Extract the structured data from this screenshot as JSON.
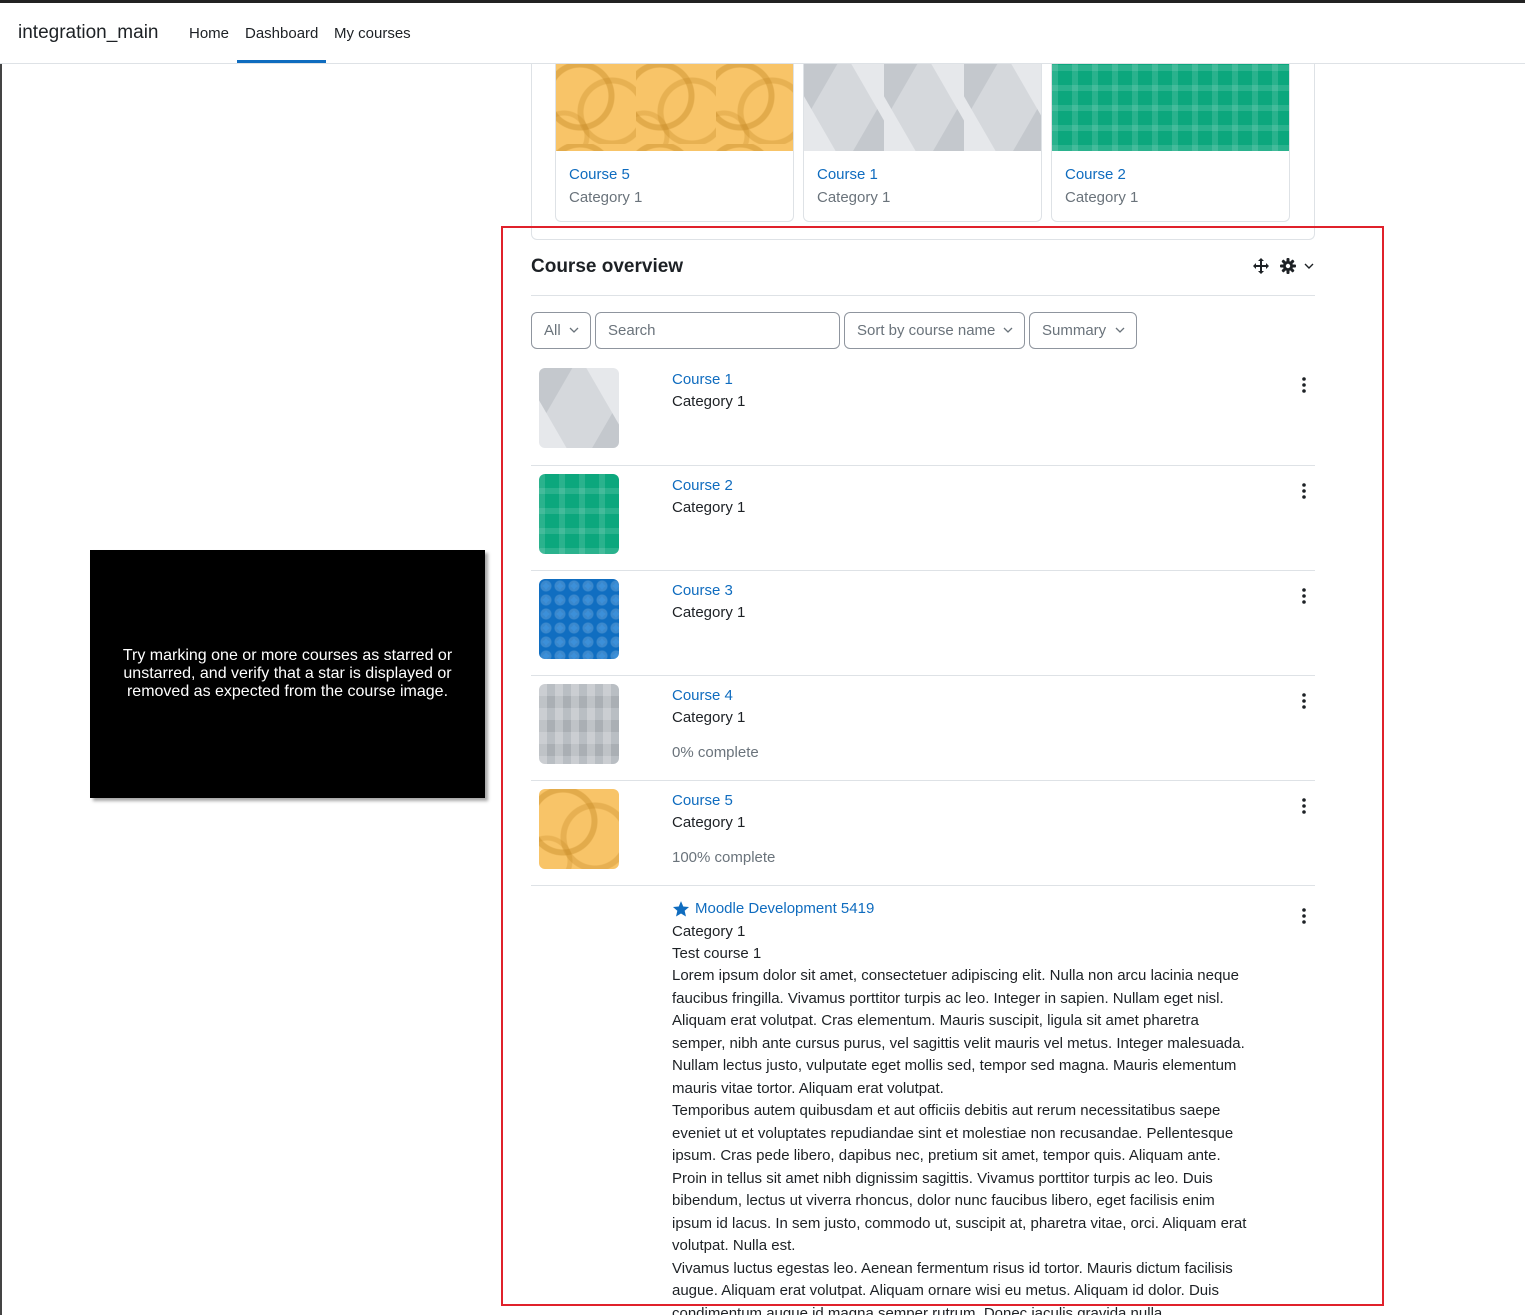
{
  "navbar": {
    "site_name": "integration_main",
    "links": [
      "Home",
      "Dashboard",
      "My courses"
    ],
    "active_link": "Dashboard"
  },
  "recent_courses": [
    {
      "name": "Course 5",
      "category": "Category 1",
      "image": "orange-circles"
    },
    {
      "name": "Course 1",
      "category": "Category 1",
      "image": "grey-triangles"
    },
    {
      "name": "Course 2",
      "category": "Category 1",
      "image": "green-plaid"
    }
  ],
  "overview": {
    "title": "Course overview",
    "icons": [
      "move-icon",
      "gear-icon",
      "chevron-down-icon"
    ],
    "filters": {
      "grouping": "All",
      "search_placeholder": "Search",
      "sort": "Sort by course name",
      "view": "Summary"
    },
    "courses": [
      {
        "name": "Course 1",
        "category": "Category 1",
        "progress": "",
        "image": "grey-triangles"
      },
      {
        "name": "Course 2",
        "category": "Category 1",
        "progress": "",
        "image": "green-plaid"
      },
      {
        "name": "Course 3",
        "category": "Category 1",
        "progress": "",
        "image": "blue-dots"
      },
      {
        "name": "Course 4",
        "category": "Category 1",
        "progress": "0% complete",
        "image": "grey-mosaic"
      },
      {
        "name": "Course 5",
        "category": "Category 1",
        "progress": "100% complete",
        "image": "orange-circles"
      }
    ],
    "starred_course": {
      "name": "Moodle Development 5419",
      "starred": true,
      "category": "Category 1",
      "shortname": "Test course 1",
      "summary": [
        "Lorem ipsum dolor sit amet, consectetuer adipiscing elit. Nulla non arcu lacinia neque faucibus fringilla. Vivamus porttitor turpis ac leo. Integer in sapien. Nullam eget nisl. Aliquam erat volutpat. Cras elementum. Mauris suscipit, ligula sit amet pharetra semper, nibh ante cursus purus, vel sagittis velit mauris vel metus. Integer malesuada. Nullam lectus justo, vulputate eget mollis sed, tempor sed magna. Mauris elementum mauris vitae tortor. Aliquam erat volutpat.",
        "Temporibus autem quibusdam et aut officiis debitis aut rerum necessitatibus saepe eveniet ut et voluptates repudiandae sint et molestiae non recusandae. Pellentesque ipsum. Cras pede libero, dapibus nec, pretium sit amet, tempor quis. Aliquam ante. Proin in tellus sit amet nibh dignissim sagittis. Vivamus porttitor turpis ac leo. Duis bibendum, lectus ut viverra rhoncus, dolor nunc faucibus libero, eget facilisis enim ipsum id lacus. In sem justo, commodo ut, suscipit at, pharetra vitae, orci. Aliquam erat volutpat. Nulla est.",
        "Vivamus luctus egestas leo. Aenean fermentum risus id tortor. Mauris dictum facilisis augue. Aliquam erat volutpat. Aliquam ornare wisi eu metus. Aliquam id dolor. Duis condimentum augue id magna semper rutrum. Donec iaculis gravida nulla."
      ]
    }
  },
  "instruction": "Try marking one or more courses as starred or unstarred, and verify that a star is displayed or removed as expected from the course image.",
  "colors": {
    "link": "#0f6cbf",
    "highlight": "#e0212b",
    "muted": "#6a737b"
  }
}
